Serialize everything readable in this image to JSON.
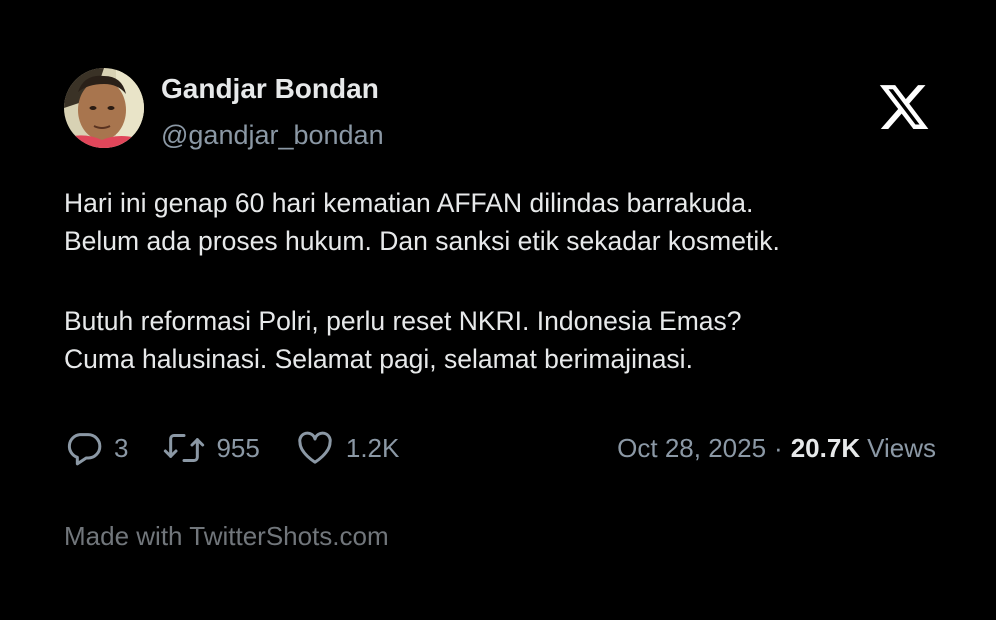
{
  "author": {
    "display_name": "Gandjar Bondan",
    "handle": "@gandjar_bondan",
    "avatar_icon": "person-photo-avatar"
  },
  "platform": {
    "logo_icon": "x-logo"
  },
  "tweet": {
    "lines": [
      "Hari ini genap 60 hari kematian AFFAN dilindas barrakuda.",
      "Belum ada proses hukum. Dan sanksi etik sekadar kosmetik.",
      "Butuh reformasi Polri, perlu reset NKRI. Indonesia Emas?",
      "Cuma halusinasi. Selamat pagi, selamat berimajinasi."
    ]
  },
  "metrics": {
    "replies": "3",
    "retweets": "955",
    "likes": "1.2K",
    "reply_icon": "speech-bubble-icon",
    "retweet_icon": "retweet-arrows-icon",
    "like_icon": "heart-icon"
  },
  "meta": {
    "date": "Oct 28, 2025",
    "separator": "·",
    "views_count": "20.7K",
    "views_label": "Views"
  },
  "footer": {
    "text": "Made with TwitterShots.com"
  },
  "colors": {
    "background": "#000000",
    "primary_text": "#e7e9ea",
    "secondary_text": "#8b98a5",
    "footer_text": "#71767b"
  }
}
